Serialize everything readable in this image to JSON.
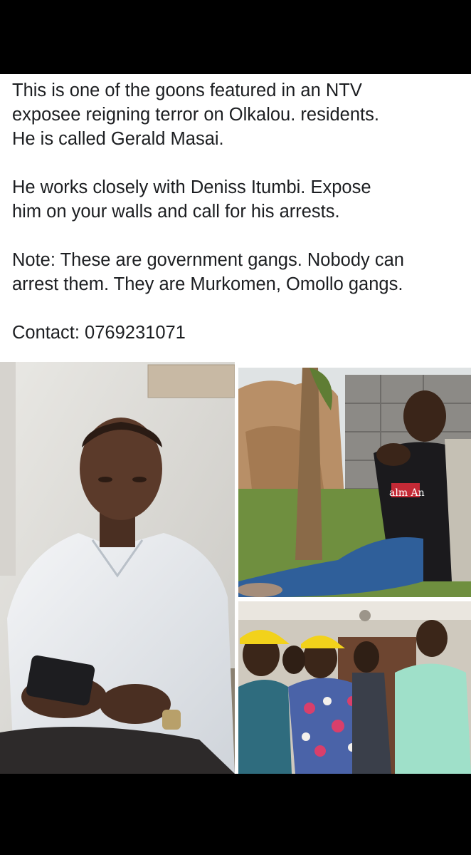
{
  "post": {
    "paragraph_1": [
      "This is one of the goons featured in an NTV",
      "exposee reigning terror on Olkalou. residents.",
      "He is called Gerald Masai."
    ],
    "paragraph_2": [
      "He works closely with Deniss Itumbi. Expose",
      "him on your walls and call for his arrests."
    ],
    "paragraph_3": [
      "Note: These are government gangs. Nobody can",
      "arrest them. They are Murkomen, Omollo gangs."
    ],
    "contact": "Contact: 0769231071"
  },
  "photos": {
    "main_photo": {
      "subject": "man-in-white-shirt-with-phone"
    },
    "top_right_photo": {
      "subject": "man-sitting-by-tree",
      "shirt_text": "alm An"
    },
    "bottom_right_photo": {
      "subject": "group-of-men-yellow-caps"
    }
  },
  "colors": {
    "background": "#000000",
    "card": "#ffffff",
    "text": "#1c1e21",
    "cap_yellow": "#f2d21b"
  }
}
